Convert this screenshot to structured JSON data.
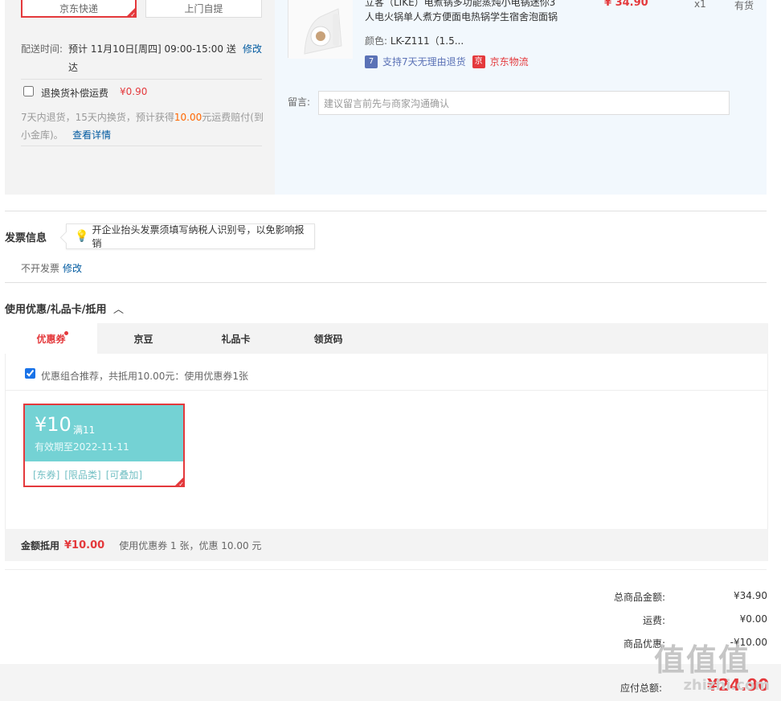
{
  "shipping": {
    "options": [
      "京东快递",
      "上门自提"
    ],
    "delivery_label": "配送时间:",
    "delivery_value_1": "预计 11月10日[周四] 09:00-15:00 送",
    "delivery_value_2": "达",
    "delivery_edit": "修改",
    "return_insurance_label": "退换货补偿运费",
    "return_insurance_price": "¥0.90",
    "return_desc_1": "7天内退货，15天内换货，预计获得",
    "return_desc_amount": "10.00",
    "return_desc_2": "元运费赔付(到",
    "return_desc_3": "小金库)。",
    "return_detail_link": "查看详情"
  },
  "product": {
    "title_line1": "立客（LIKE）电煮锅多功能蒸炖小电锅迷你3",
    "title_line2": "人电火锅单人煮方便面电热锅学生宿舍泡面锅",
    "price": "¥ 34.90",
    "qty": "x1",
    "stock": "有货",
    "color_label": "颜色:",
    "color_value": "LK-Z111（1.5...",
    "service_7day": "支持7天无理由退货",
    "service_7day_icon": "7",
    "jd_logistics": "京东物流",
    "jd_logistics_icon": "京",
    "message_label": "留言:",
    "message_placeholder": "建议留言前先与商家沟通确认"
  },
  "invoice": {
    "title": "发票信息",
    "tip": "开企业抬头发票须填写纳税人识别号，以免影响报销",
    "status": "不开发票",
    "edit": "修改"
  },
  "discounts": {
    "title": "使用优惠/礼品卡/抵用",
    "tabs": [
      "优惠券",
      "京豆",
      "礼品卡",
      "领货码"
    ],
    "recommend_text": "优惠组合推荐，共抵用10.00元：使用优惠券1张",
    "coupon": {
      "amount": "¥10",
      "threshold": "满11",
      "valid": "有效期至2022-11-11",
      "tags": [
        "[东券]",
        "[限品类]",
        "[可叠加]"
      ]
    },
    "amount_label": "金额抵用",
    "amount_value": "¥10.00",
    "amount_desc": "使用优惠券 1 张，优惠 10.00 元"
  },
  "totals": {
    "items_label": "总商品金额:",
    "items_value": "¥34.90",
    "shipping_label": "运费:",
    "shipping_value": "¥0.00",
    "discount_label": "商品优惠:",
    "discount_value": "-¥10.00",
    "pay_label": "应付总额:",
    "pay_value": "¥24.90"
  },
  "watermark": {
    "text": "值值值",
    "url": "zhizhi.com"
  }
}
